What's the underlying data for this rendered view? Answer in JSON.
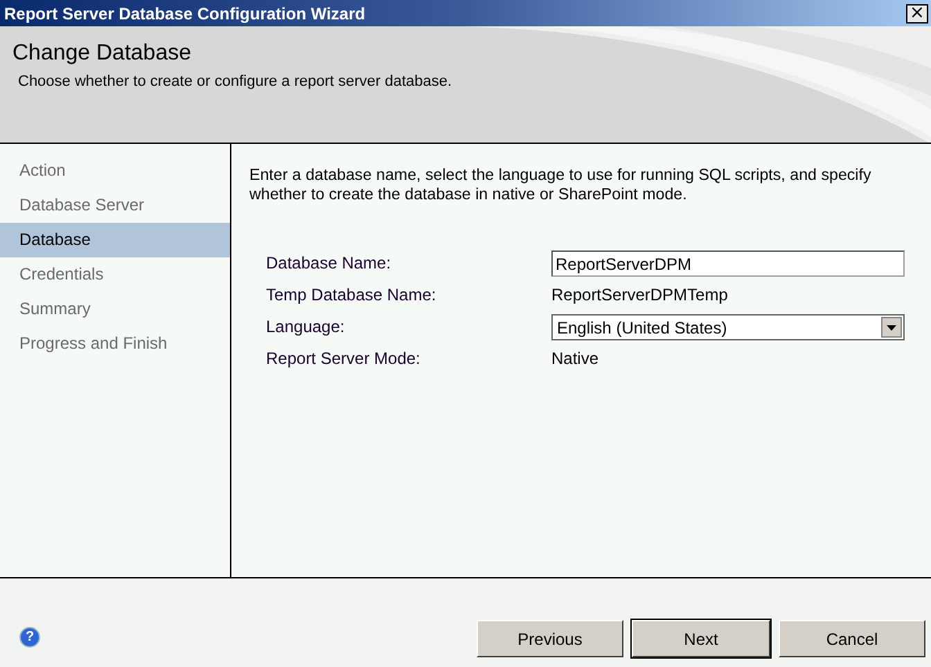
{
  "window": {
    "title": "Report Server Database Configuration Wizard",
    "close": "×"
  },
  "header": {
    "title": "Change Database",
    "subtitle": "Choose whether to create or configure a report server database."
  },
  "sidebar": {
    "items": [
      {
        "label": "Action",
        "selected": false
      },
      {
        "label": "Database Server",
        "selected": false
      },
      {
        "label": "Database",
        "selected": true
      },
      {
        "label": "Credentials",
        "selected": false
      },
      {
        "label": "Summary",
        "selected": false
      },
      {
        "label": "Progress and Finish",
        "selected": false
      }
    ]
  },
  "content": {
    "intro": "Enter a database name, select the language to use for running SQL scripts, and specify whether to create the database in native or SharePoint mode.",
    "fields": [
      {
        "kind": "input",
        "label": "Database Name:",
        "value": "ReportServerDPM"
      },
      {
        "kind": "text",
        "label": "Temp Database Name:",
        "value": "ReportServerDPMTemp"
      },
      {
        "kind": "select",
        "label": "Language:",
        "value": "English (United States)"
      },
      {
        "kind": "text",
        "label": "Report Server Mode:",
        "value": "Native"
      }
    ]
  },
  "footer": {
    "help": "?",
    "buttons": [
      {
        "label": "Previous",
        "default": false
      },
      {
        "label": "Next",
        "default": true
      },
      {
        "label": "Cancel",
        "default": false
      }
    ]
  }
}
